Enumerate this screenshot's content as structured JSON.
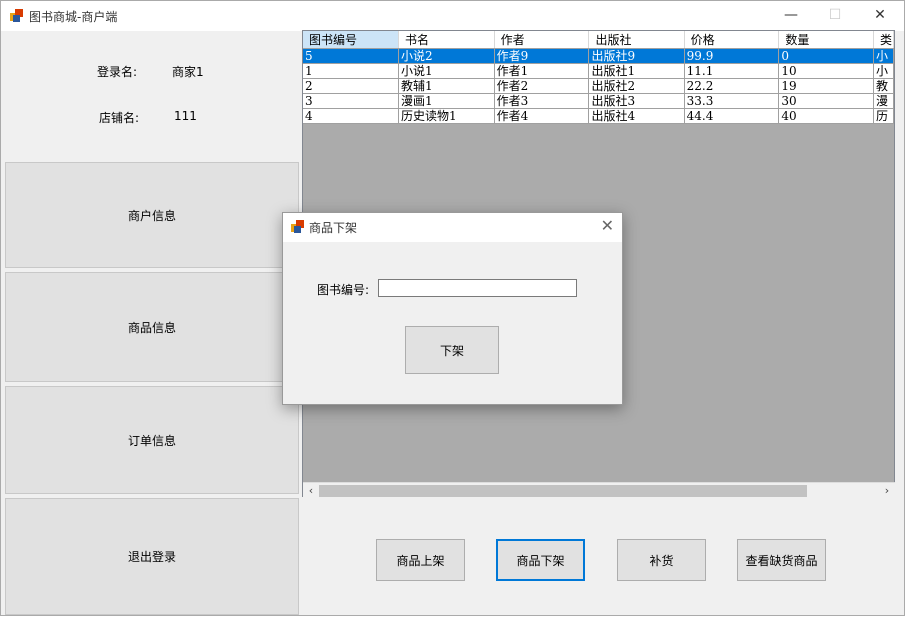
{
  "window": {
    "title": "图书商城-商户端",
    "minimize_glyph": "—",
    "maximize_glyph": "☐",
    "close_glyph": "✕"
  },
  "merchant_info": {
    "login_label": "登录名:",
    "login_value": "商家1",
    "shop_label": "店铺名:",
    "shop_value": "111"
  },
  "nav": {
    "merchant_info": "商户信息",
    "product_info": "商品信息",
    "order_info": "订单信息",
    "logout": "退出登录"
  },
  "grid": {
    "columns": [
      "图书编号",
      "书名",
      "作者",
      "出版社",
      "价格",
      "数量",
      "类"
    ],
    "rows": [
      [
        "5",
        "小说2",
        "作者9",
        "出版社9",
        "99.9",
        "0",
        "小"
      ],
      [
        "1",
        "小说1",
        "作者1",
        "出版社1",
        "11.1",
        "10",
        "小"
      ],
      [
        "2",
        "教辅1",
        "作者2",
        "出版社2",
        "22.2",
        "19",
        "教"
      ],
      [
        "3",
        "漫画1",
        "作者3",
        "出版社3",
        "33.3",
        "30",
        "漫"
      ],
      [
        "4",
        "历史读物1",
        "作者4",
        "出版社4",
        "44.4",
        "40",
        "历"
      ]
    ],
    "selected_row": 0,
    "scroll_left_glyph": "‹",
    "scroll_right_glyph": "›"
  },
  "actions": {
    "list_product": "商品上架",
    "delist_product": "商品下架",
    "restock": "补货",
    "view_out_of_stock": "查看缺货商品"
  },
  "dialog": {
    "title": "商品下架",
    "close_glyph": "✕",
    "field_label": "图书编号:",
    "field_value": "",
    "confirm_label": "下架"
  },
  "colors": {
    "selection": "#0078d7",
    "grid_background": "#ababab",
    "button_face": "#e1e1e1"
  }
}
